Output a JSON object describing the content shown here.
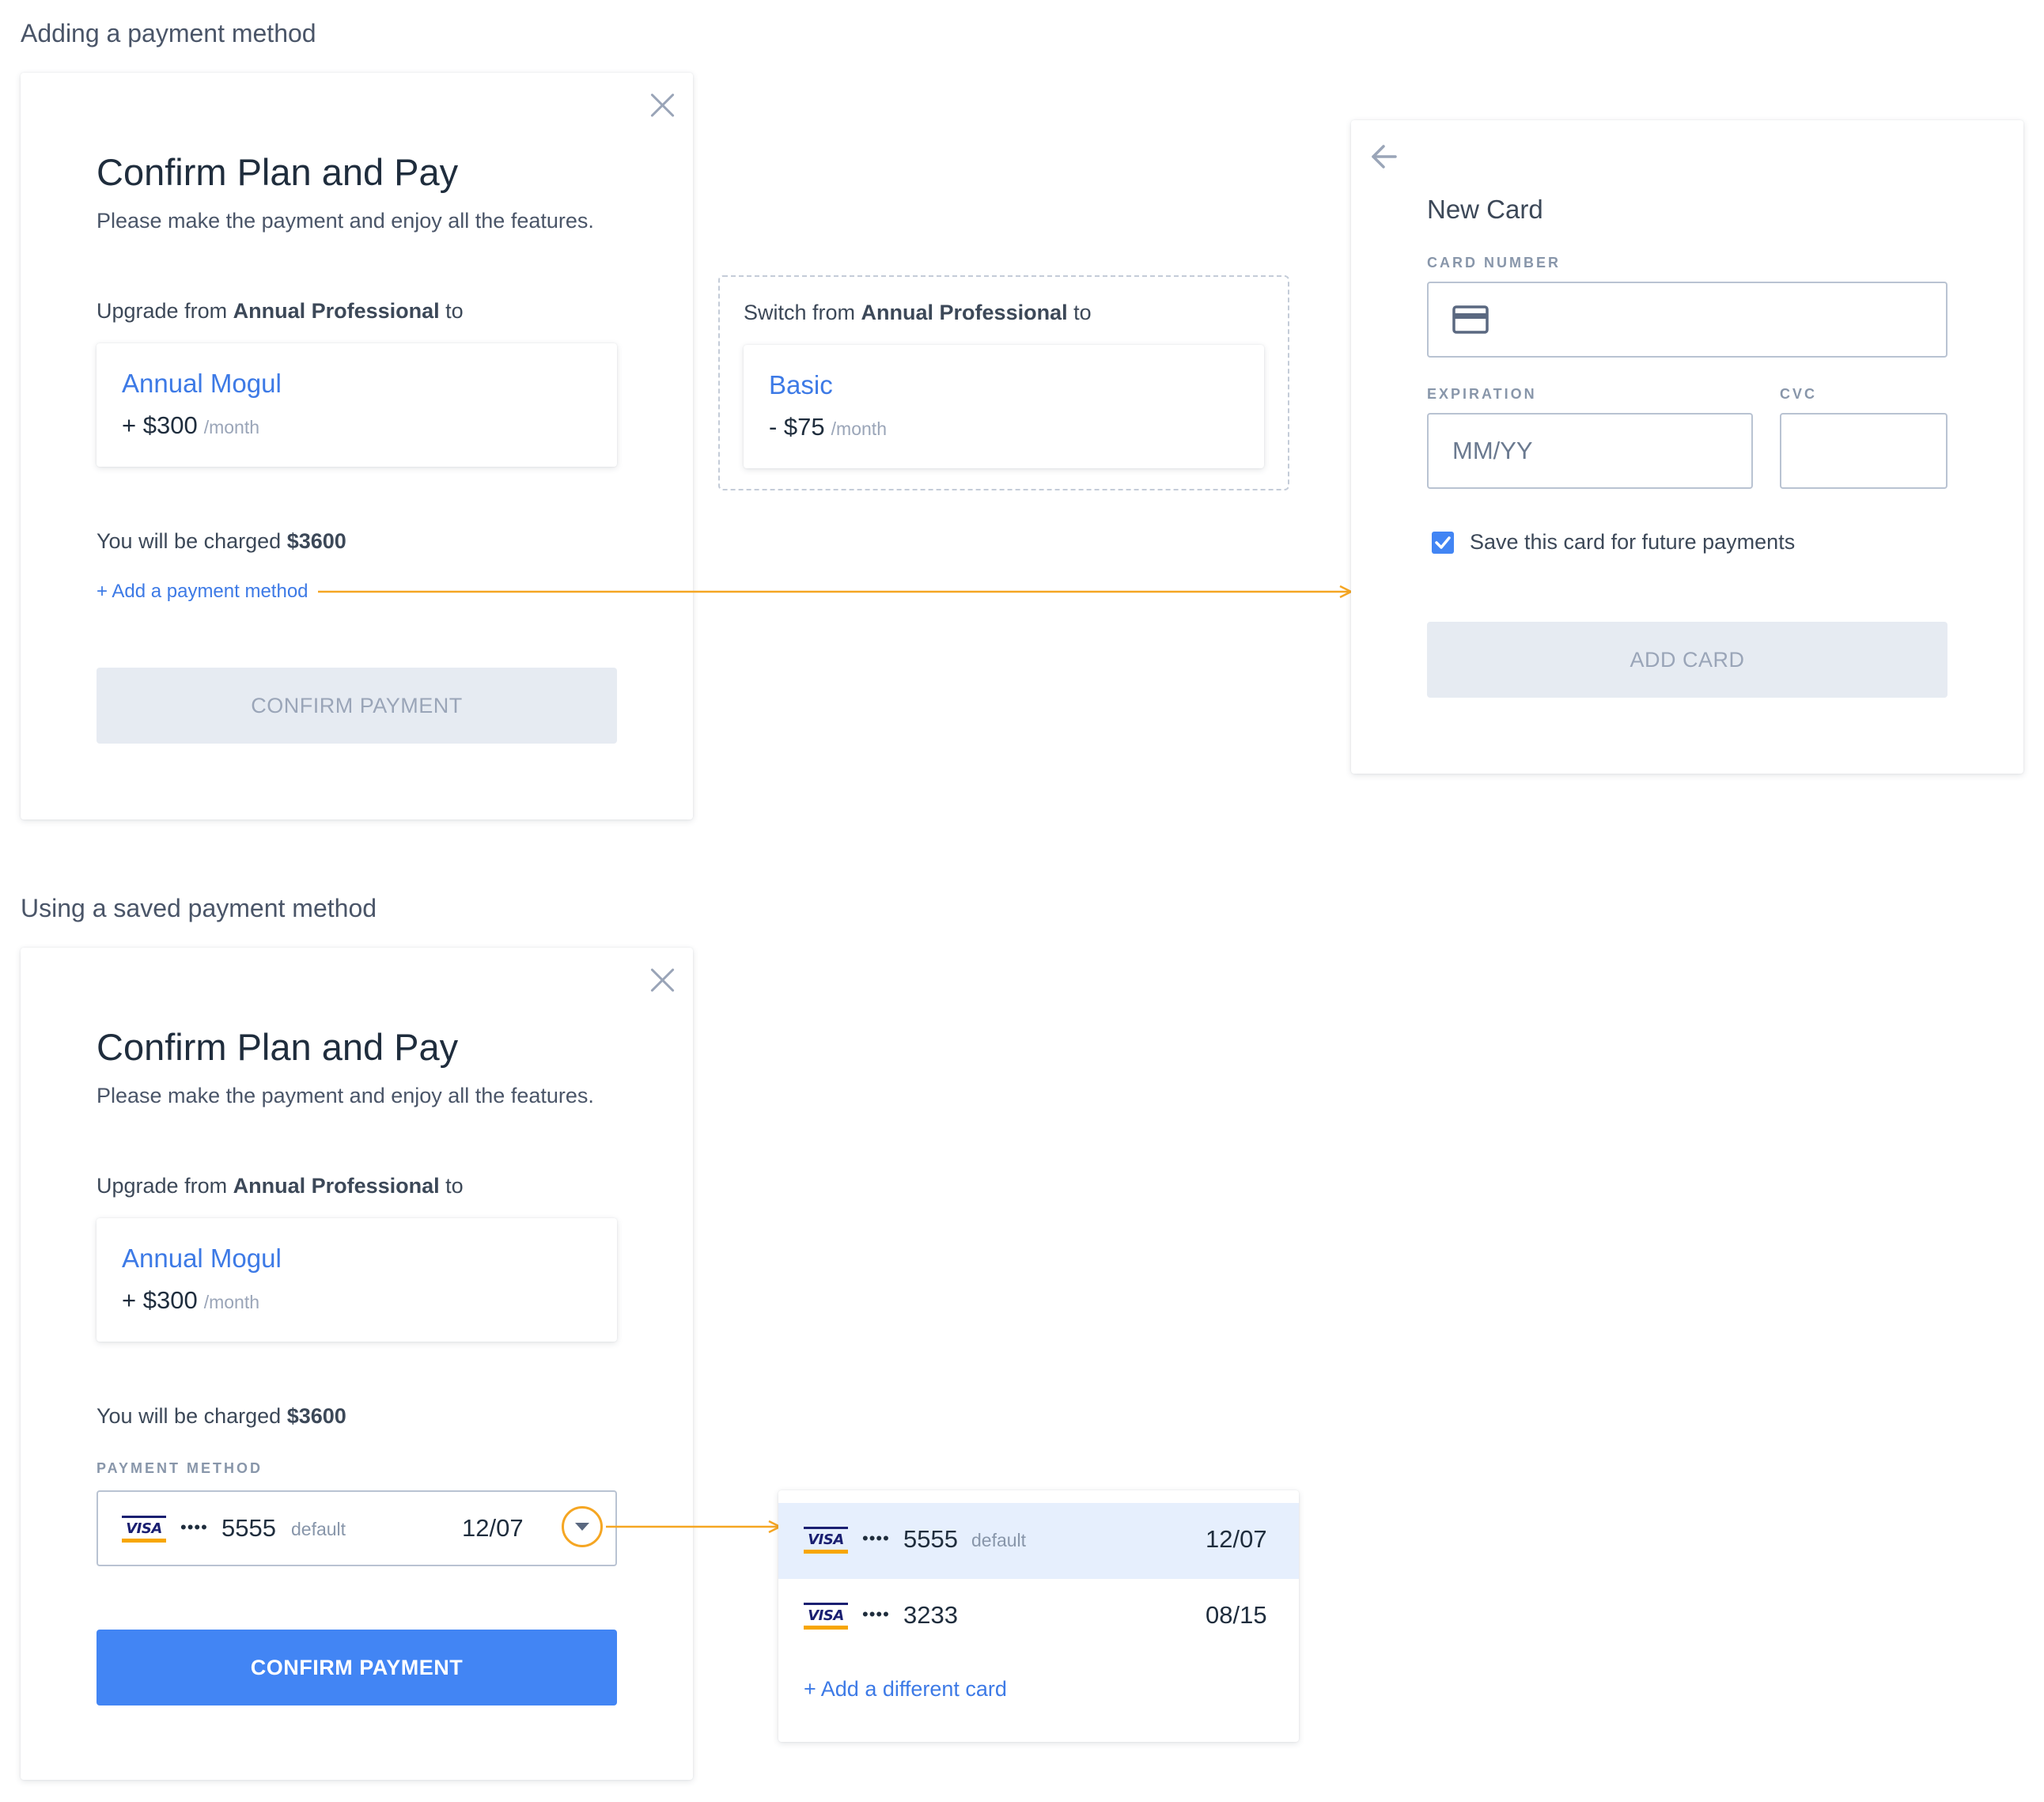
{
  "sections": {
    "adding_title": "Adding a payment method",
    "saved_title": "Using a saved payment method"
  },
  "dialog": {
    "title": "Confirm Plan and Pay",
    "subtitle": "Please make the payment and enjoy all the features.",
    "upgrade_prefix": "Upgrade from",
    "current_plan": "Annual Professional",
    "upgrade_suffix": "to",
    "target_plan": {
      "name": "Annual Mogul",
      "price": "+ $300",
      "period": "/month"
    },
    "charge_prefix": "You will be charged",
    "charge_amount": "$3600",
    "add_payment_link": "+ Add a payment method",
    "confirm_label": "CONFIRM PAYMENT",
    "payment_method_label": "PAYMENT METHOD"
  },
  "switch_option": {
    "prefix": "Switch from",
    "current_plan": "Annual Professional",
    "suffix": "to",
    "plan": {
      "name": "Basic",
      "price": "- $75",
      "period": "/month"
    }
  },
  "new_card": {
    "title": "New Card",
    "card_number_label": "CARD NUMBER",
    "expiration_label": "EXPIRATION",
    "expiration_placeholder": "MM/YY",
    "cvc_label": "CVC",
    "save_card_label": "Save this card for future payments",
    "save_card_checked": true,
    "add_card_label": "ADD CARD"
  },
  "saved_cards": [
    {
      "brand": "VISA",
      "dots": "••••",
      "last4": "5555",
      "badge": "default",
      "exp": "12/07",
      "selected": true
    },
    {
      "brand": "VISA",
      "dots": "••••",
      "last4": "3233",
      "badge": "",
      "exp": "08/15",
      "selected": false
    }
  ],
  "add_different_card": "+ Add a different card",
  "colors": {
    "accent": "#4285f4",
    "link": "#3d7ae6",
    "annotation": "#f5a623",
    "selected_row": "#e6effd",
    "disabled": "#e6ebf2"
  }
}
